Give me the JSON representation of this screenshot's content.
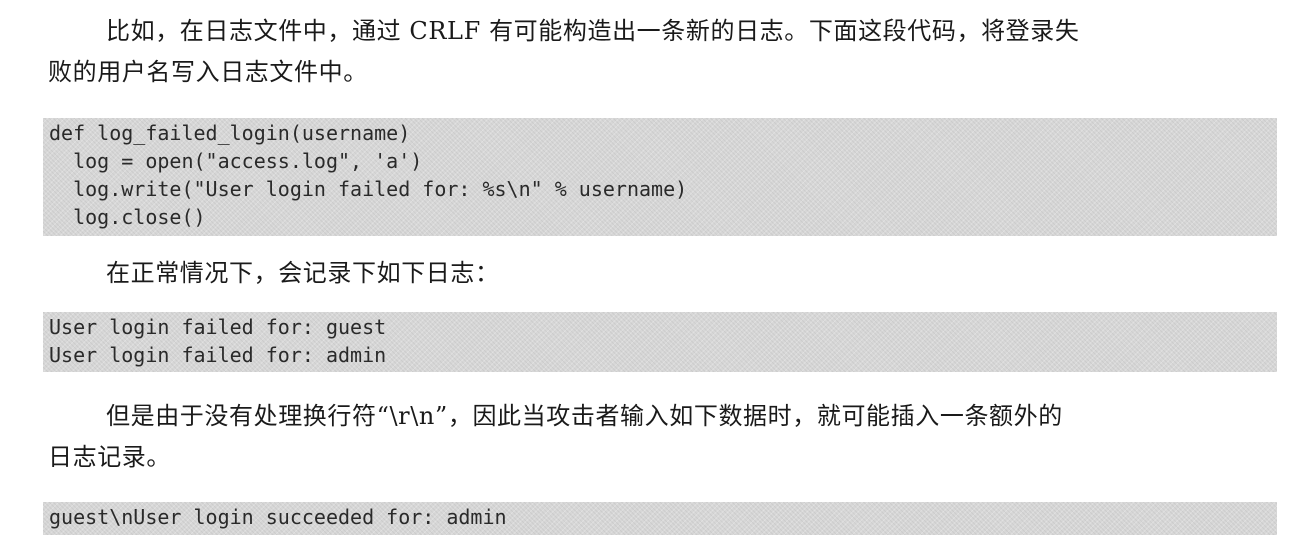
{
  "paragraphs": [
    {
      "line1": "比如，在日志文件中，通过 CRLF 有可能构造出一条新的日志。下面这段代码，将登录失",
      "line2": "败的用户名写入日志文件中。"
    },
    {
      "line1": "在正常情况下，会记录下如下日志："
    },
    {
      "line1": "但是由于没有处理换行符“\\r\\n”，因此当攻击者输入如下数据时，就可能插入一条额外的",
      "line2": "日志记录。"
    }
  ],
  "code_blocks": [
    {
      "lines": [
        "def log_failed_login(username)",
        "  log = open(\"access.log\", 'a')",
        "  log.write(\"User login failed for: %s\\n\" % username)",
        "  log.close()"
      ]
    },
    {
      "lines": [
        "User login failed for: guest",
        "User login failed for: admin"
      ]
    },
    {
      "lines": [
        "guest\\nUser login succeeded for: admin"
      ]
    }
  ]
}
